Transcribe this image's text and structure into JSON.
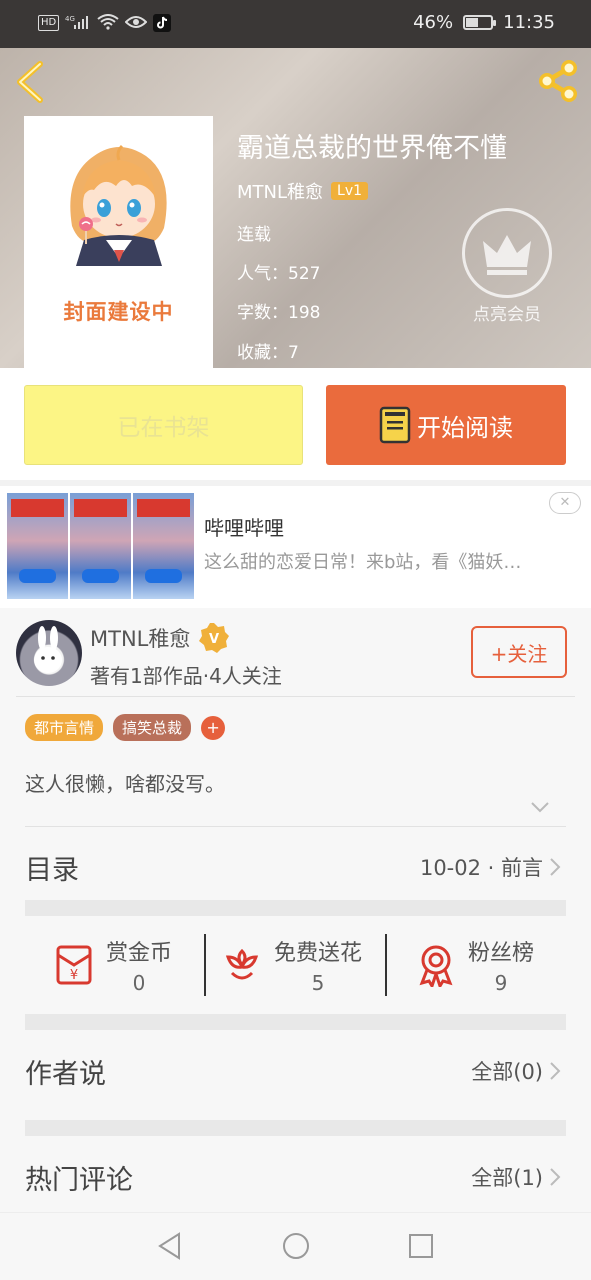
{
  "status_bar": {
    "hd_label": "HD",
    "network_label": "4G",
    "battery_percent": "46%",
    "battery_level": 0.46,
    "time": "11:35",
    "icons": [
      "hd-icon",
      "signal-icon",
      "wifi-icon",
      "eye-icon",
      "tiktok-icon",
      "battery-icon"
    ]
  },
  "book": {
    "title": "霸道总裁的世界俺不懂",
    "author": "MTNL稚愈",
    "level": "Lv1",
    "status": "连载",
    "popularity": "人气：527",
    "word_count": "字数：198",
    "favorites": "收藏：7",
    "cover_text": "封面建设中",
    "vip_label": "点亮会员"
  },
  "actions": {
    "shelf_label": "已在书架",
    "read_label": "开始阅读"
  },
  "ad": {
    "title": "哔哩哔哩",
    "description": "这么甜的恋爱日常！来b站，看《猫妖…",
    "close_symbol": "✕"
  },
  "author": {
    "name": "MTNL稚愈",
    "badge": "V",
    "stats": "著有1部作品·4人关注",
    "follow_label": "+关注",
    "tags": [
      {
        "label": "都市言情",
        "color": "#f0a83a"
      },
      {
        "label": "搞笑总裁",
        "color": "#b9705a"
      }
    ],
    "tag_add": "+",
    "bio": "这人很懒，啥都没写。"
  },
  "catalog": {
    "title": "目录",
    "latest": "10-02 · 前言"
  },
  "rewards": [
    {
      "label": "赏金币",
      "value": "0",
      "icon": "red-envelope-icon"
    },
    {
      "label": "免费送花",
      "value": "5",
      "icon": "flower-icon"
    },
    {
      "label": "粉丝榜",
      "value": "9",
      "icon": "medal-icon"
    }
  ],
  "author_says": {
    "title": "作者说",
    "link": "全部(0)"
  },
  "hot_comments": {
    "title": "热门评论",
    "link": "全部(1)"
  },
  "colors": {
    "accent": "#ea6b3d",
    "shelf_button": "#fcf585",
    "level_badge": "#f0b03a",
    "icon_red": "#d8392f"
  }
}
